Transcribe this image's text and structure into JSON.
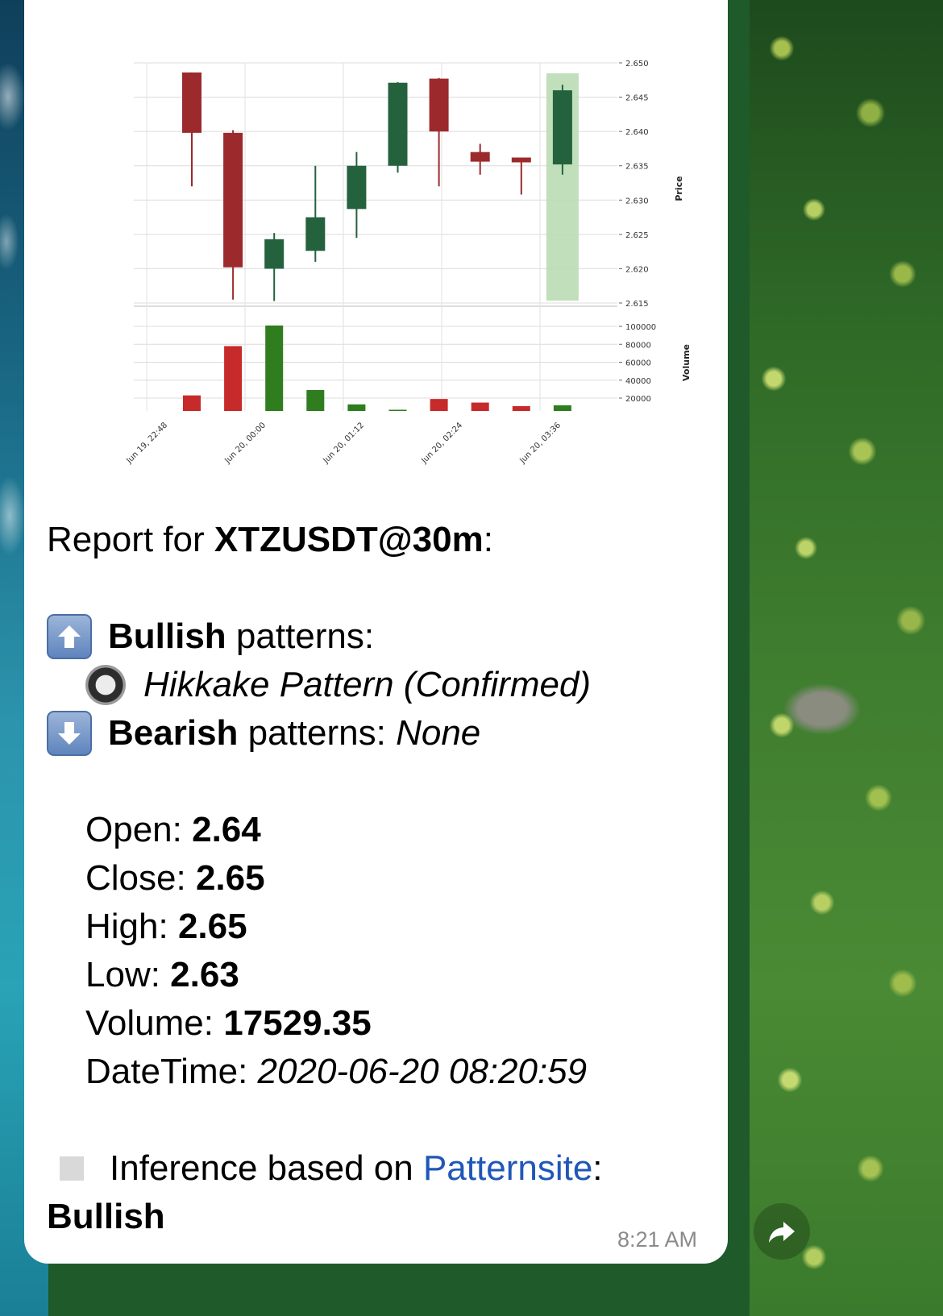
{
  "message": {
    "report_prefix": "Report for ",
    "symbol": "XTZUSDT@30m",
    "report_suffix": ":",
    "bullish_label": "Bullish",
    "bullish_rest": " patterns:",
    "bullish_item": "Hikkake Pattern (Confirmed)",
    "bearish_label": "Bearish",
    "bearish_rest": " patterns: ",
    "bearish_value": "None",
    "open_label": "Open: ",
    "open_value": "2.64",
    "close_label": "Close: ",
    "close_value": "2.65",
    "high_label": "High: ",
    "high_value": "2.65",
    "low_label": "Low: ",
    "low_value": "2.63",
    "volume_label": "Volume: ",
    "volume_value": "17529.35",
    "datetime_label": "DateTime: ",
    "datetime_value": "2020-06-20 08:20:59",
    "inference_prefix": "Inference based on ",
    "inference_link": "Patternsite",
    "inference_suffix": ":",
    "inference_result": "Bullish",
    "time": "8:21 AM"
  },
  "icons": {
    "bullish": "up-arrow-emoji-icon",
    "bearish": "down-arrow-emoji-icon",
    "bullet": "radio-button-emoji-icon",
    "inference": "white-square-emoji-icon",
    "share": "share-arrow-icon"
  },
  "colors": {
    "bullish_candle": "#24623d",
    "bearish_candle": "#9c2a2d",
    "bullish_volume": "#2f7d1f",
    "bearish_volume": "#c62a2a",
    "highlight": "#b9dbb2",
    "link": "#2057b8"
  },
  "chart_data": {
    "type": "candlestick",
    "title": "",
    "ylabel": "Price",
    "volume_label": "Volume",
    "ylim": [
      2.615,
      2.65
    ],
    "price_ticks": [
      "2.650",
      "2.645",
      "2.640",
      "2.635",
      "2.630",
      "2.625",
      "2.620",
      "2.615"
    ],
    "volume_ylim": [
      0,
      100000
    ],
    "volume_ticks": [
      "100000",
      "80000",
      "60000",
      "40000",
      "20000"
    ],
    "x_tick_labels": [
      "Jun 19, 22:48",
      "Jun 20, 00:00",
      "Jun 20, 01:12",
      "Jun 20, 02:24",
      "Jun 20, 03:36"
    ],
    "candles": [
      {
        "open": 2.6486,
        "close": 2.6398,
        "high": 2.6486,
        "low": 2.632,
        "volume": 23000
      },
      {
        "open": 2.6398,
        "close": 2.6202,
        "high": 2.6402,
        "low": 2.6155,
        "volume": 78000
      },
      {
        "open": 2.62,
        "close": 2.6243,
        "high": 2.6252,
        "low": 2.6153,
        "volume": 101000
      },
      {
        "open": 2.6226,
        "close": 2.6275,
        "high": 2.635,
        "low": 2.621,
        "volume": 29000
      },
      {
        "open": 2.6287,
        "close": 2.635,
        "high": 2.637,
        "low": 2.6245,
        "volume": 13000
      },
      {
        "open": 2.635,
        "close": 2.6471,
        "high": 2.6472,
        "low": 2.634,
        "volume": 7000
      },
      {
        "open": 2.6477,
        "close": 2.64,
        "high": 2.6478,
        "low": 2.632,
        "volume": 19000
      },
      {
        "open": 2.637,
        "close": 2.6356,
        "high": 2.6382,
        "low": 2.6337,
        "volume": 15000
      },
      {
        "open": 2.6362,
        "close": 2.6355,
        "high": 2.6362,
        "low": 2.6308,
        "volume": 11000
      },
      {
        "open": 2.6352,
        "close": 2.646,
        "high": 2.6468,
        "low": 2.6337,
        "volume": 12000
      }
    ],
    "highlight_index": 9,
    "grid": true
  }
}
